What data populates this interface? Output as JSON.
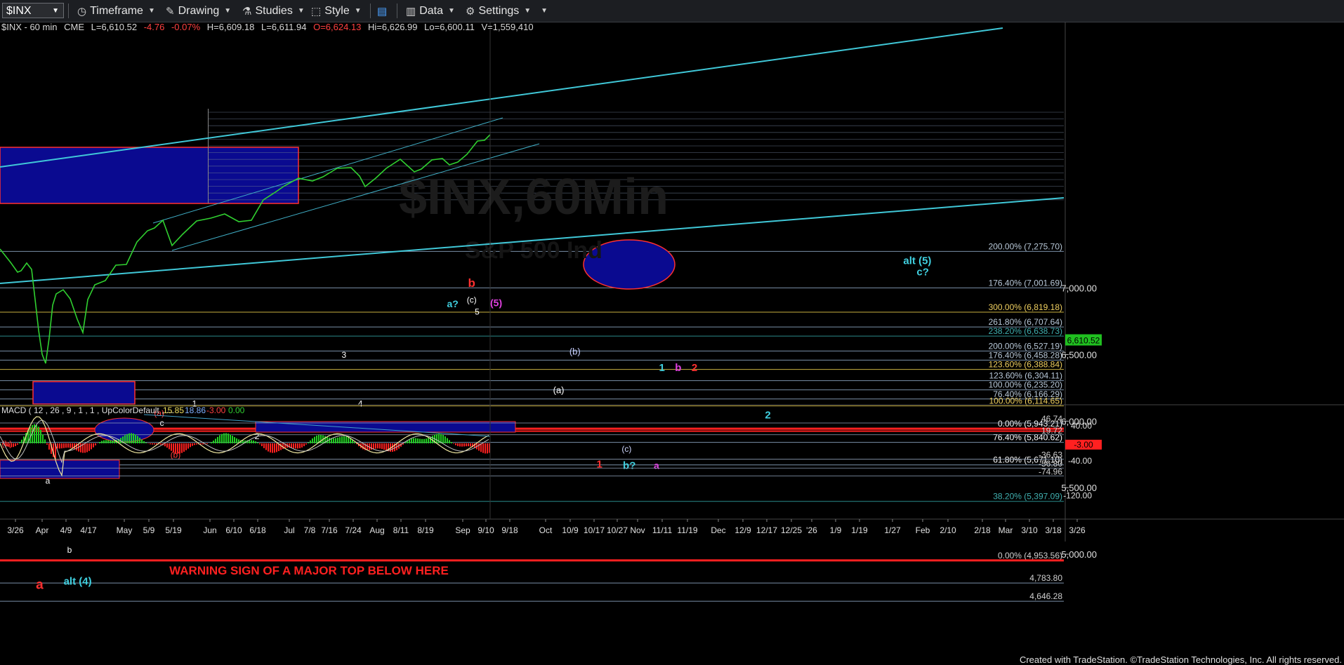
{
  "toolbar": {
    "symbol": "$INX",
    "timeframe": "Timeframe",
    "drawing": "Drawing",
    "studies": "Studies",
    "style": "Style",
    "data": "Data",
    "settings": "Settings"
  },
  "infobar": {
    "name": "$INX - 60 min",
    "exchange": "CME",
    "last": "L=6,610.52",
    "change": "-4.76",
    "change_pct": "-0.07%",
    "high_prev": "H=6,609.18",
    "low_prev": "L=6,611.94",
    "open": "O=6,624.13",
    "high": "Hi=6,626.99",
    "low": "Lo=6,600.11",
    "volume": "V=1,559,410"
  },
  "watermark": {
    "symbol": "$INX,60Min",
    "name": "S&P 500 Ind"
  },
  "warning_text": "WARNING SIGN OF A MAJOR TOP BELOW HERE",
  "price_axis": {
    "ticks": [
      "7,000.00",
      "6,500.00",
      "6,000.00",
      "5,500.00",
      "5,000.00"
    ],
    "last_price": "6,610.52"
  },
  "fib_labels": [
    {
      "text": "200.00% (7,275.70)",
      "price": 7275.7,
      "color": "#b8c8d8"
    },
    {
      "text": "176.40% (7,001.69)",
      "price": 7001.69,
      "color": "#b8c8d8"
    },
    {
      "text": "300.00% (6,819.18)",
      "price": 6819.18,
      "color": "#f0d060"
    },
    {
      "text": "261.80% (6,707.64)",
      "price": 6707.64,
      "color": "#b8c8d8"
    },
    {
      "text": "238.20% (6,638.73)",
      "price": 6638.73,
      "color": "#40b0b0"
    },
    {
      "text": "200.00% (6,527.19)",
      "price": 6527.19,
      "color": "#b8c8d8"
    },
    {
      "text": "176.40% (6,458.28)",
      "price": 6458.28,
      "color": "#b8c8d8"
    },
    {
      "text": "123.60% (6,388.84)",
      "price": 6388.84,
      "color": "#f0d060"
    },
    {
      "text": "123.60% (6,304.11)",
      "price": 6304.11,
      "color": "#b8c8d8"
    },
    {
      "text": "100.00% (6,235.20)",
      "price": 6235.2,
      "color": "#b8c8d8"
    },
    {
      "text": "76.40% (6,166.29)",
      "price": 6166.29,
      "color": "#b8c8d8"
    },
    {
      "text": "100.00% (6,114.65)",
      "price": 6114.65,
      "color": "#f0d060"
    },
    {
      "text": "0.00% (5,943.21)",
      "price": 5943.21,
      "color": "#ffffff"
    },
    {
      "text": "76.40% (5,840.62)",
      "price": 5840.62,
      "color": "#ffffff"
    },
    {
      "text": "61.80% (5,671.10)",
      "price": 5671.1,
      "color": "#ffffff"
    },
    {
      "text": "38.20% (5,397.09)",
      "price": 5397.09,
      "color": "#40b0b0"
    },
    {
      "text": "0.00% (4,953.56)",
      "price": 4953.56,
      "color": "#d0d0d0"
    },
    {
      "text": "4,783.80",
      "price": 4783.8,
      "color": "#d0d0d0"
    },
    {
      "text": "4,646.28",
      "price": 4646.28,
      "color": "#d0d0d0"
    }
  ],
  "wave_labels": [
    {
      "text": "b",
      "price": 7010,
      "date": "2025-09-12",
      "color": "#ff3030",
      "size": 17
    },
    {
      "text": "(c)",
      "price": 6890,
      "date": "2025-09-12",
      "color": "#ffffff",
      "size": 12
    },
    {
      "text": "a?",
      "price": 6855,
      "date": "2025-09-05",
      "color": "#40d0e0",
      "size": 14
    },
    {
      "text": "5",
      "price": 6800,
      "date": "2025-09-14",
      "color": "#ffffff",
      "size": 12
    },
    {
      "text": "(5)",
      "price": 6865,
      "date": "2025-09-21",
      "color": "#e040e0",
      "size": 14
    },
    {
      "text": "3",
      "price": 6475,
      "date": "2025-07-27",
      "color": "#ffffff",
      "size": 12
    },
    {
      "text": "4",
      "price": 6110,
      "date": "2025-08-02",
      "color": "#ffffff",
      "size": 12
    },
    {
      "text": "1",
      "price": 6110,
      "date": "2025-06-02",
      "color": "#ffffff",
      "size": 12
    },
    {
      "text": "2",
      "price": 5865,
      "date": "2025-06-25",
      "color": "#ffffff",
      "size": 12
    },
    {
      "text": "(a)",
      "price": 6040,
      "date": "2025-05-20",
      "color": "#ff4040",
      "size": 12
    },
    {
      "text": "c",
      "price": 5965,
      "date": "2025-05-21",
      "color": "#ffffff",
      "size": 12
    },
    {
      "text": "(b)",
      "price": 5725,
      "date": "2025-05-26",
      "color": "#ff4040",
      "size": 12
    },
    {
      "text": "(b)",
      "price": 5810,
      "date": "2025-03-25",
      "color": "#ff4040",
      "size": 12
    },
    {
      "text": "a",
      "price": 5530,
      "date": "2025-04-09",
      "color": "#ffffff",
      "size": 12
    },
    {
      "text": "b",
      "price": 5010,
      "date": "2025-04-17",
      "color": "#ffffff",
      "size": 12
    },
    {
      "text": "(b)",
      "price": 6500,
      "date": "2025-10-20",
      "color": "#c8d0ff",
      "size": 13
    },
    {
      "text": "(a)",
      "price": 6210,
      "date": "2025-10-14",
      "color": "#ffffff",
      "size": 13
    },
    {
      "text": "1",
      "price": 6375,
      "date": "2025-11-21",
      "color": "#40d0e0",
      "size": 15
    },
    {
      "text": "b",
      "price": 6375,
      "date": "2025-11-27",
      "color": "#e040e0",
      "size": 15
    },
    {
      "text": "2",
      "price": 6375,
      "date": "2025-12-03",
      "color": "#ff3030",
      "size": 15
    },
    {
      "text": "2",
      "price": 6020,
      "date": "2025-12-30",
      "color": "#40d0e0",
      "size": 15
    },
    {
      "text": "(c)",
      "price": 5770,
      "date": "2025-11-08",
      "color": "#d0d8ff",
      "size": 12
    },
    {
      "text": "1",
      "price": 5650,
      "date": "2025-10-29",
      "color": "#ff3030",
      "size": 15
    },
    {
      "text": "b?",
      "price": 5640,
      "date": "2025-11-09",
      "color": "#40d0e0",
      "size": 15
    },
    {
      "text": "a",
      "price": 5640,
      "date": "2025-11-19",
      "color": "#e040e0",
      "size": 14
    },
    {
      "text": "alt (5)",
      "price": 7180,
      "date": "2026-02-23",
      "color": "#40d0e0",
      "size": 15
    },
    {
      "text": "c?",
      "price": 7095,
      "date": "2026-02-25",
      "color": "#40d0e0",
      "size": 15
    },
    {
      "text": "a",
      "price": 4740,
      "date": "2025-04-06",
      "color": "#ff3030",
      "size": 19
    },
    {
      "text": "alt (4)",
      "price": 4770,
      "date": "2025-04-20",
      "color": "#40d0e0",
      "size": 15
    }
  ],
  "macd": {
    "title": "MACD ( 12 , 26 , 9 , 1 , 1 , UpColorDefault , ...",
    "v1": "15.85",
    "v2": "18.86",
    "v3": "-3.00",
    "v4": "0.00",
    "ticks": [
      "40.00",
      "-40.00",
      "-120.00"
    ],
    "levels": [
      "46.74",
      "19.72",
      "-36.63",
      "-56.80",
      "-74.96"
    ],
    "last": "-3.00"
  },
  "date_axis": [
    "3/26",
    "Apr",
    "4/9",
    "4/17",
    "May",
    "5/9",
    "5/19",
    "Jun",
    "6/10",
    "6/18",
    "Jul",
    "7/8",
    "7/16",
    "7/24",
    "Aug",
    "8/11",
    "8/19",
    "Sep",
    "9/10",
    "9/18",
    "Oct",
    "10/9",
    "10/17",
    "10/27",
    "Nov",
    "11/11",
    "11/19",
    "Dec",
    "12/9",
    "12/17",
    "12/25",
    "'26",
    "1/9",
    "1/19",
    "1/27",
    "Feb",
    "2/10",
    "2/18",
    "Mar",
    "3/10",
    "3/18",
    "3/26",
    "Apr"
  ],
  "footer": "Created with TradeStation. ©TradeStation Technologies, Inc. All rights reserved."
}
